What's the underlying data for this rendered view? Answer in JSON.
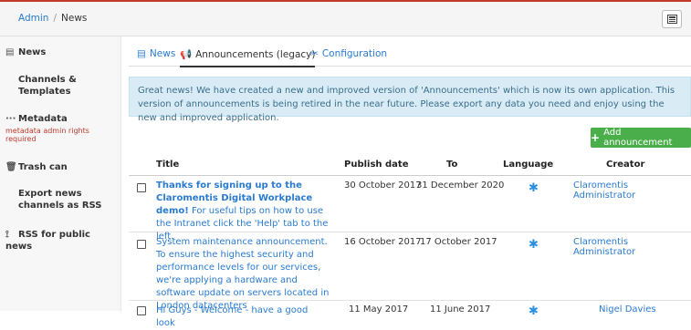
{
  "breadcrumb": {
    "root": "Admin",
    "separator": "/",
    "current": "News"
  },
  "topbar": {
    "icon": "document-icon"
  },
  "sidebar": {
    "items": [
      {
        "icon": "newspaper-icon",
        "glyph": "▤",
        "label": "News"
      },
      {
        "icon": "channels-icon",
        "glyph": "⚟",
        "label": "Channels & Templates"
      },
      {
        "icon": "ellipsis-icon",
        "glyph": "···",
        "label": "Metadata",
        "warning": "metadata admin rights required"
      },
      {
        "icon": "trash-icon",
        "glyph": "🗑",
        "label": "Trash can"
      },
      {
        "icon": "rss-icon",
        "glyph": "⟟",
        "label": "Export news channels as RSS"
      },
      {
        "icon": "rss-icon",
        "glyph": "⟟",
        "label": "RSS for public news"
      }
    ]
  },
  "tabs": [
    {
      "icon": "newspaper-icon",
      "glyph": "▤",
      "label": "News"
    },
    {
      "icon": "megaphone-icon",
      "glyph": "📢",
      "label": "Announcements (legacy)"
    },
    {
      "icon": "tools-icon",
      "glyph": "✂",
      "label": "Configuration"
    }
  ],
  "alert": "Great news! We have created a new and improved version of 'Announcements' which is now its own application. This version of announcements is being retired in the near future. Please export any data you need and enjoy using the new and improved application.",
  "add_button": "Add announcement",
  "table": {
    "headers": [
      "Title",
      "Publish date",
      "To",
      "Language",
      "Creator"
    ],
    "rows": [
      {
        "title_bold": "Thanks for signing up to the Claromentis Digital Workplace demo!",
        "title_rest": " For useful tips on how to use the Intranet click the 'Help' tab to the left.",
        "publish": "30 October 2017",
        "to": "31 December 2020",
        "language": "✱",
        "creator": "Claromentis Administrator"
      },
      {
        "title_bold": "",
        "title_rest": "System maintenance announcement. To ensure the highest security and performance levels for our services, we're applying a hardware and software update on servers located in London datacenters",
        "publish": "16 October 2017",
        "to": "17 October 2017",
        "language": "✱",
        "creator": "Claromentis Administrator"
      },
      {
        "title_bold": "",
        "title_rest": "Hi Guys - Welcome - have a good look",
        "publish": "11 May 2017",
        "to": "11 June 2017",
        "language": "✱",
        "creator": "Nigel Davies"
      }
    ]
  },
  "colors": {
    "accent": "#2a7bd0",
    "success": "#4aae4a",
    "alert_bg": "#d9ecf5",
    "warning": "#c0392b"
  }
}
